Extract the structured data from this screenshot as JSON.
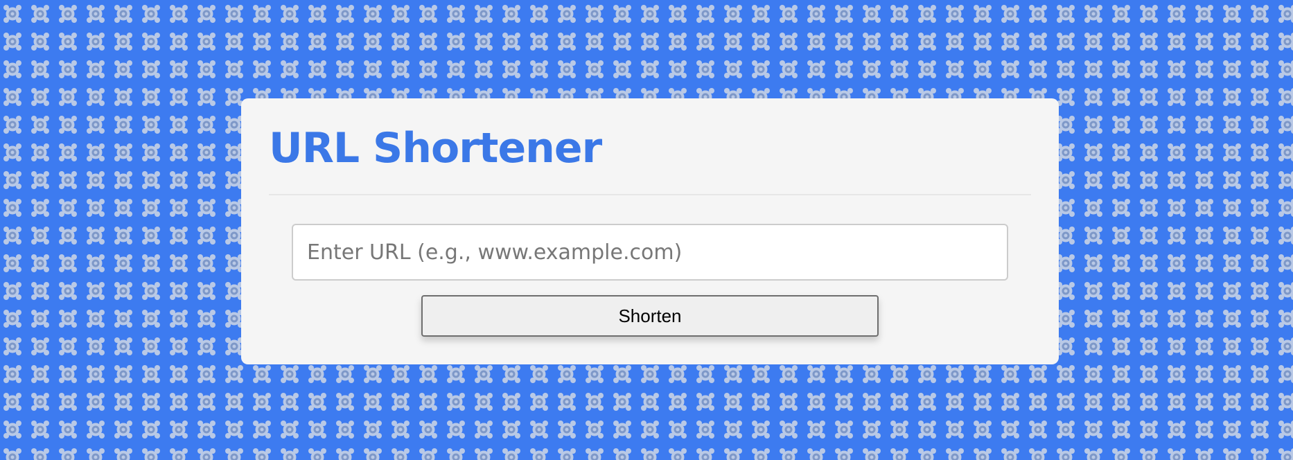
{
  "page": {
    "background_color": "#3d7bf0",
    "background_pattern_icon": "gear-pattern-icon"
  },
  "card": {
    "title": "URL Shortener",
    "title_color": "#3b78e7"
  },
  "form": {
    "url_input": {
      "value": "",
      "placeholder": "Enter URL (e.g., www.example.com)"
    },
    "shorten_button_label": "Shorten"
  }
}
